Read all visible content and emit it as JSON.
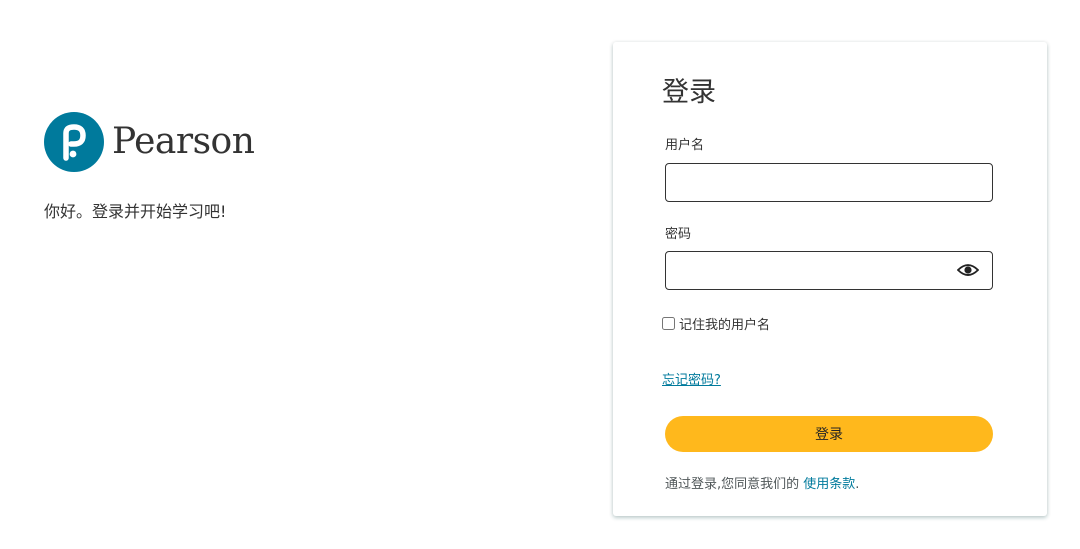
{
  "brand": {
    "logo_icon": "pearson-p-icon",
    "name": "Pearson",
    "tagline": "你好。登录并开始学习吧!",
    "color": "#007A9C"
  },
  "login": {
    "title": "登录",
    "username_label": "用户名",
    "username_value": "",
    "password_label": "密码",
    "password_value": "",
    "show_password_icon": "eye-icon",
    "remember_label": "记住我的用户名",
    "remember_checked": false,
    "forgot_link": "忘记密码?",
    "submit_label": "登录",
    "terms_prefix": "通过登录,您同意我们的",
    "terms_link": "使用条款",
    "terms_suffix": "."
  },
  "colors": {
    "accent_button": "#FFB81C",
    "link": "#007A9C"
  }
}
